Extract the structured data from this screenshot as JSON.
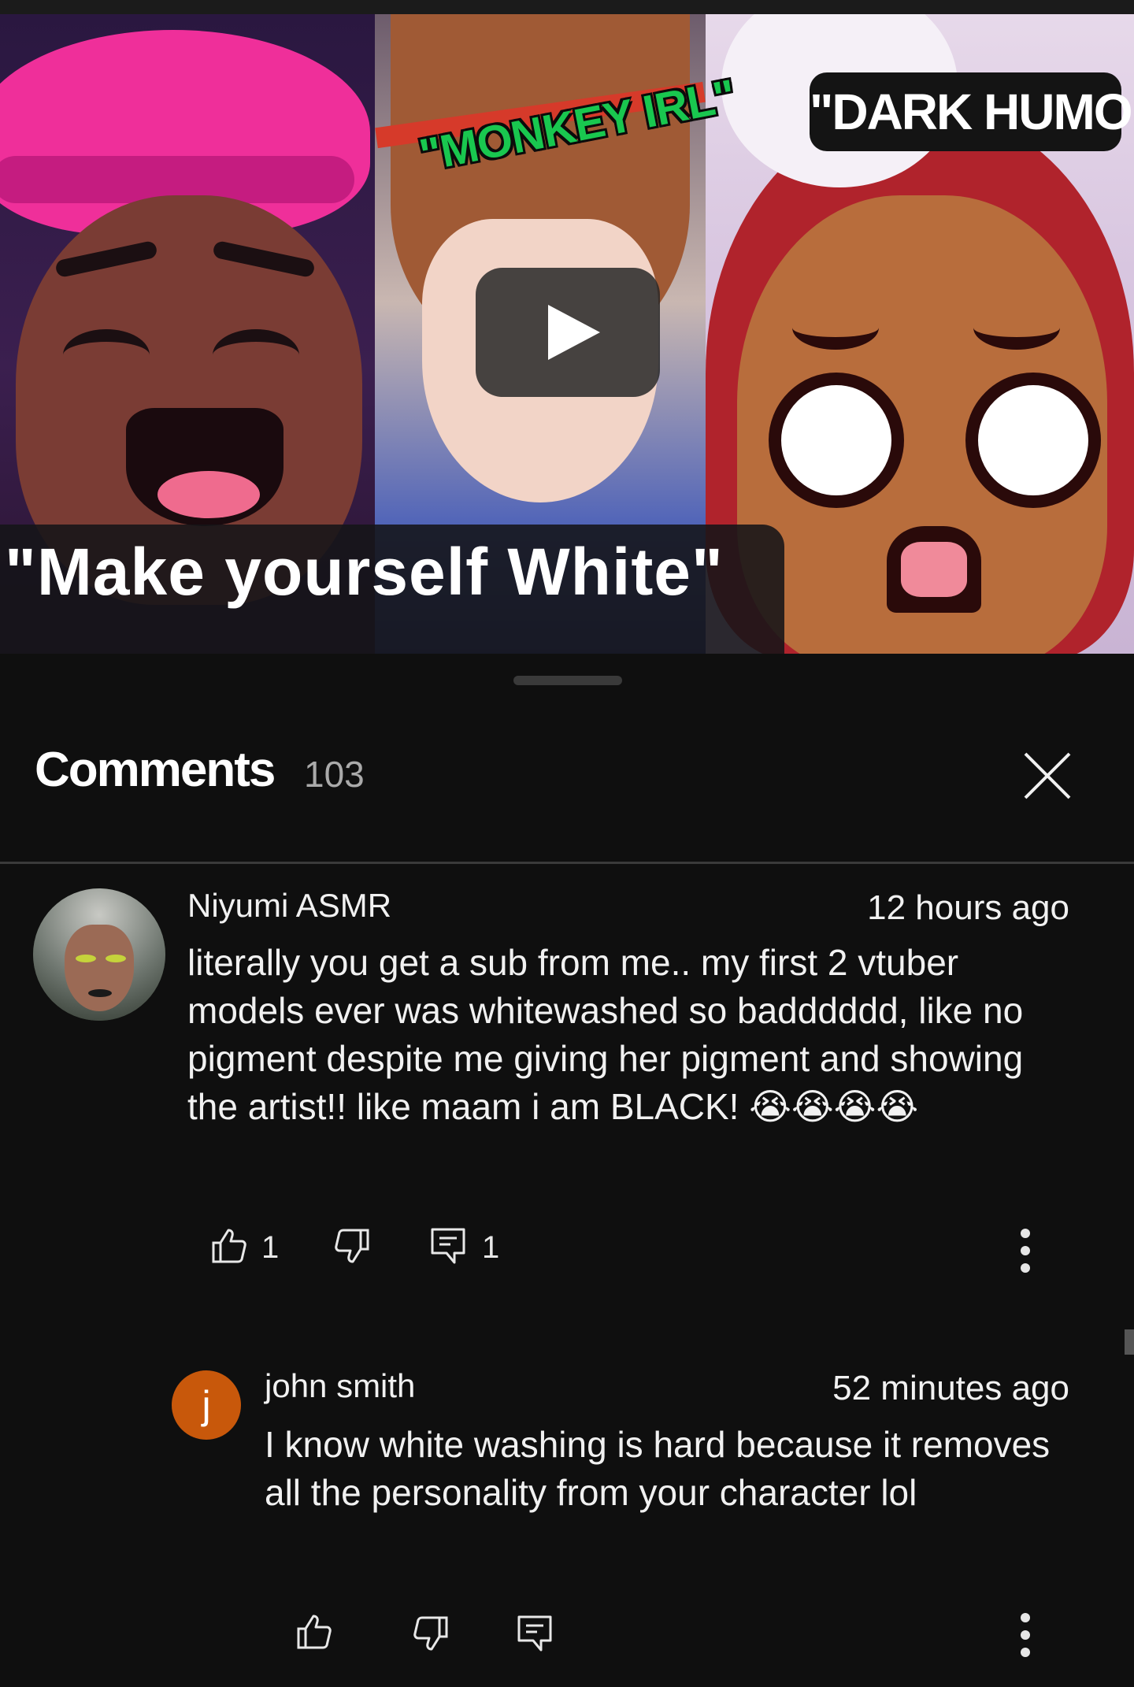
{
  "video": {
    "tag_monkey": "\"MONKEY IRL\"",
    "tag_dark": "\"DARK HUMOR\"",
    "caption": "\"Make yourself White\""
  },
  "comments_panel": {
    "title": "Comments",
    "count": "103",
    "icons": {
      "close": "close-icon",
      "like": "thumbs-up-icon",
      "dislike": "thumbs-down-icon",
      "reply": "reply-icon",
      "more": "more-vertical-icon"
    },
    "comments": [
      {
        "author": "Niyumi ASMR",
        "time": "12 hours ago",
        "text": "literally you get a sub from me.. my first 2 vtuber models ever was whitewashed so badddddd, like no pigment despite me giving her pigment and showing the artist!! like maam i am BLACK! 😭😭😭😭",
        "likes": "1",
        "replies": "1"
      },
      {
        "author": "john smith",
        "avatar_letter": "j",
        "avatar_color": "#c8580b",
        "time": "52 minutes ago",
        "text": "I know white washing is hard because it removes all the personality from your character lol"
      }
    ]
  }
}
